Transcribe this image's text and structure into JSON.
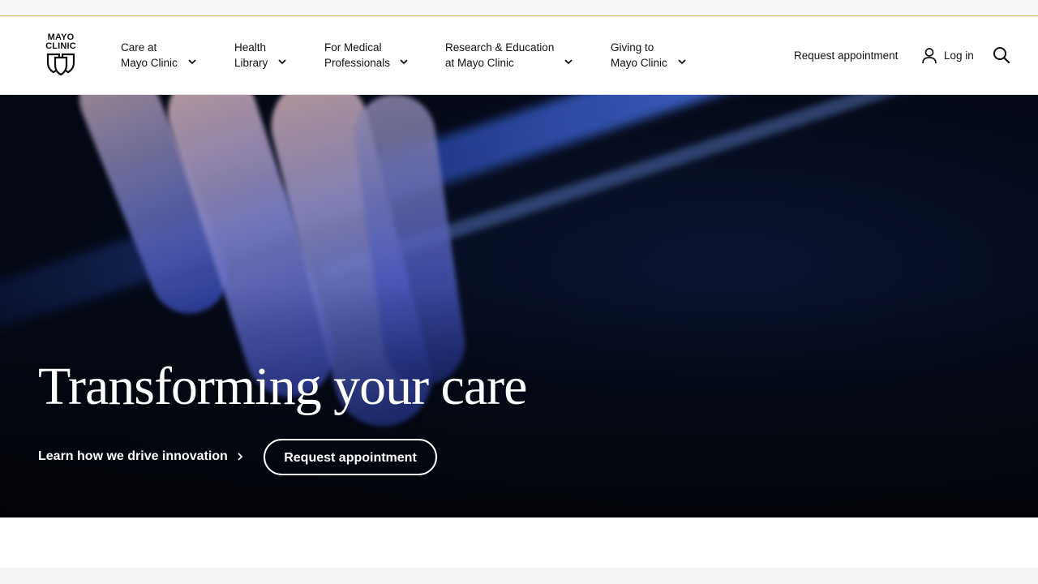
{
  "logo": {
    "line1": "MAYO",
    "line2": "CLINIC"
  },
  "nav": {
    "items": [
      {
        "line1": "Care at",
        "line2": "Mayo Clinic"
      },
      {
        "line1": "Health",
        "line2": "Library"
      },
      {
        "line1": "For Medical",
        "line2": "Professionals"
      },
      {
        "line1": "Research & Education",
        "line2": "at Mayo Clinic"
      },
      {
        "line1": "Giving to",
        "line2": "Mayo Clinic"
      }
    ],
    "request_appointment": "Request appointment",
    "login": "Log in"
  },
  "icons": {
    "user": "user-icon",
    "search": "search-icon",
    "chevron": "chevron-down-icon"
  },
  "hero": {
    "headline": "Transforming your care",
    "learn_link": "Learn how we drive innovation",
    "cta_button": "Request appointment"
  },
  "colors": {
    "accent_line": "#d8b06a",
    "hero_bg": "#060b1a",
    "text_dark": "#111111",
    "text_light": "#ffffff"
  }
}
